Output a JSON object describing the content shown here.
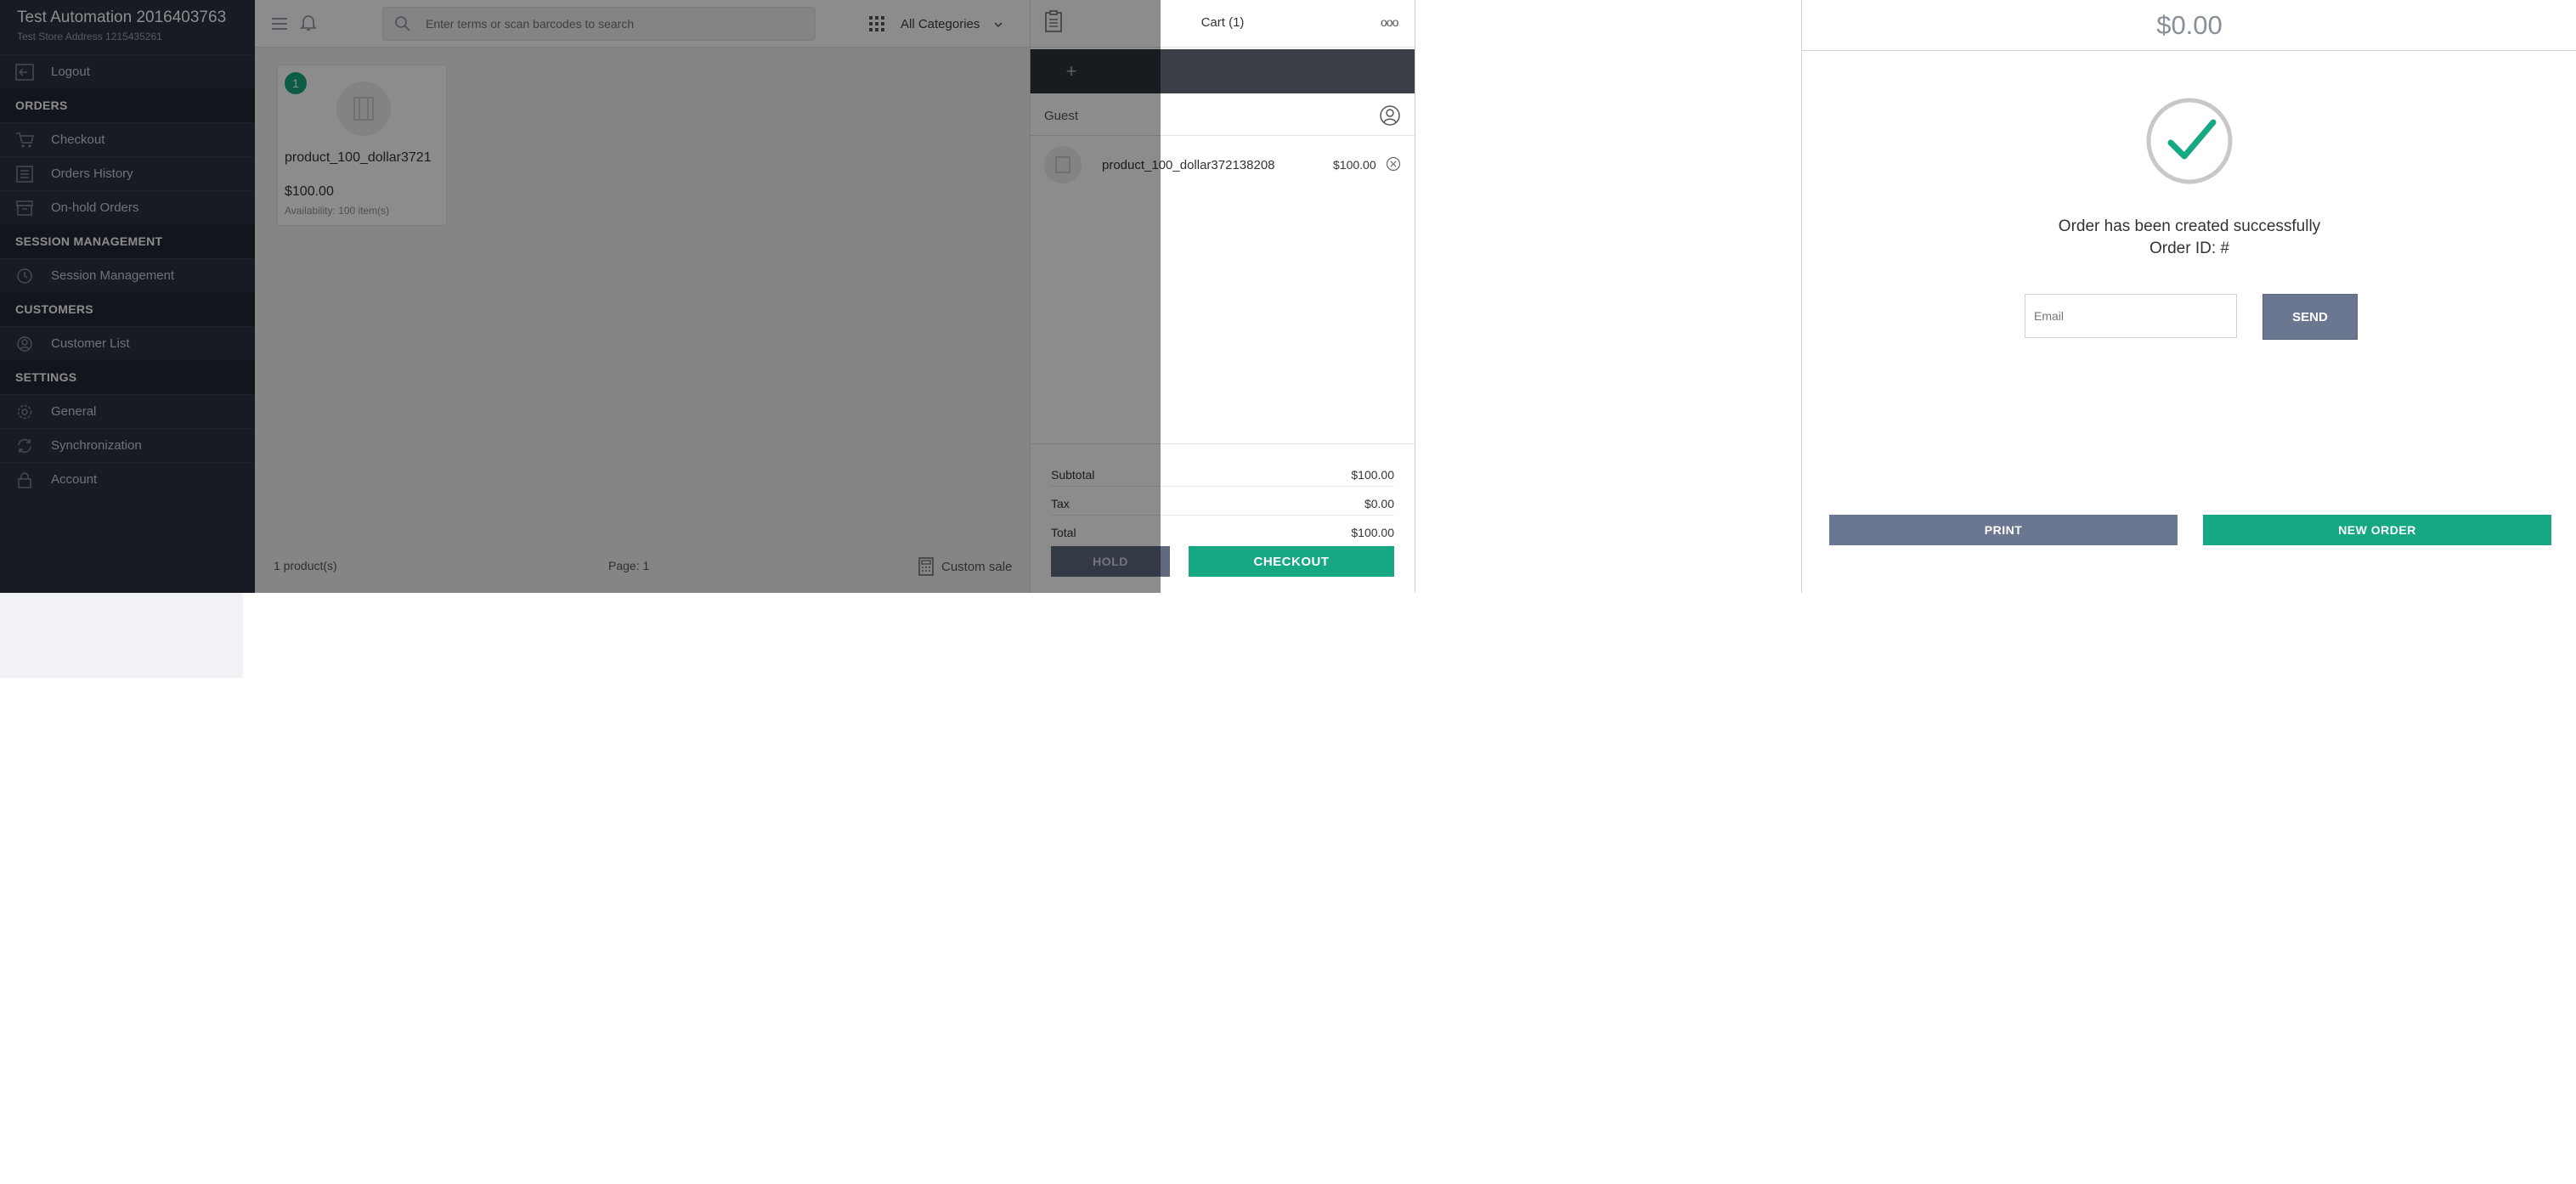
{
  "sidebar": {
    "store_name": "Test Automation 2016403763",
    "store_address": "Test Store Address 1215435261",
    "logout_label": "Logout",
    "sections": {
      "orders": "ORDERS",
      "session": "SESSION MANAGEMENT",
      "customers": "CUSTOMERS",
      "settings": "SETTINGS"
    },
    "items": {
      "checkout": "Checkout",
      "orders_history": "Orders History",
      "onhold": "On-hold Orders",
      "session_management": "Session Management",
      "customer_list": "Customer List",
      "general": "General",
      "synchronization": "Synchronization",
      "account": "Account"
    }
  },
  "topbar": {
    "search_placeholder": "Enter terms or scan barcodes to search",
    "category_label": "All Categories"
  },
  "products": {
    "card": {
      "qty_badge": "1",
      "name": "product_100_dollar3721",
      "price": "$100.00",
      "availability": "Availability: 100 item(s)"
    },
    "footer": {
      "count": "1 product(s)",
      "page": "Page: 1",
      "custom_sale": "Custom sale"
    }
  },
  "cart": {
    "title": "Cart (1)",
    "menu_dots": "ooo",
    "add_symbol": "+",
    "customer": "Guest",
    "line": {
      "name": "product_100_dollar372138208",
      "price": "$100.00"
    },
    "totals": {
      "subtotal_label": "Subtotal",
      "subtotal": "$100.00",
      "tax_label": "Tax",
      "tax": "$0.00",
      "total_label": "Total",
      "total": "$100.00"
    },
    "hold_label": "HOLD",
    "checkout_label": "CHECKOUT"
  },
  "success": {
    "amount": "$0.00",
    "message": "Order has been created successfully",
    "order_id": "Order ID: #",
    "email_placeholder": "Email",
    "send_label": "SEND",
    "print_label": "PRINT",
    "new_order_label": "NEW ORDER"
  },
  "colors": {
    "sidebar_bg": "#2b3442",
    "accent_green": "#15a883",
    "slate_button": "#6b7690"
  }
}
